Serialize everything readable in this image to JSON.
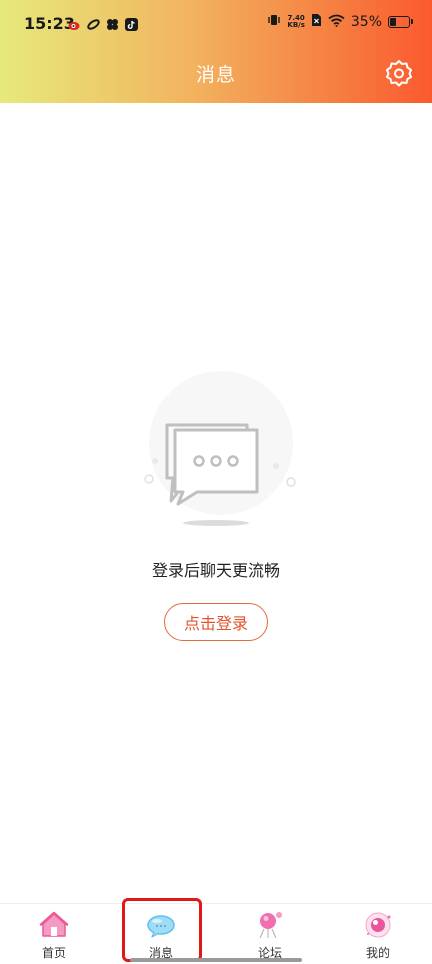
{
  "status_bar": {
    "time": "15:23",
    "net_speed_value": "7.40",
    "net_speed_unit": "KB/s",
    "battery_percent": "35%",
    "battery_level": 0.35
  },
  "header": {
    "title": "消息",
    "settings_icon": "settings-gear-icon"
  },
  "empty_state": {
    "message": "登录后聊天更流畅",
    "login_button": "点击登录",
    "illustration_icon": "chat-bubbles-icon"
  },
  "bottom_nav": {
    "items": [
      {
        "label": "首页",
        "icon": "home-icon"
      },
      {
        "label": "消息",
        "icon": "message-icon",
        "active": true
      },
      {
        "label": "论坛",
        "icon": "forum-icon"
      },
      {
        "label": "我的",
        "icon": "profile-icon"
      }
    ]
  },
  "colors": {
    "header_gradient_start": "#e6ea7c",
    "header_gradient_end": "#fb5a2f",
    "accent": "#e2542d",
    "highlight": "#e01818"
  }
}
